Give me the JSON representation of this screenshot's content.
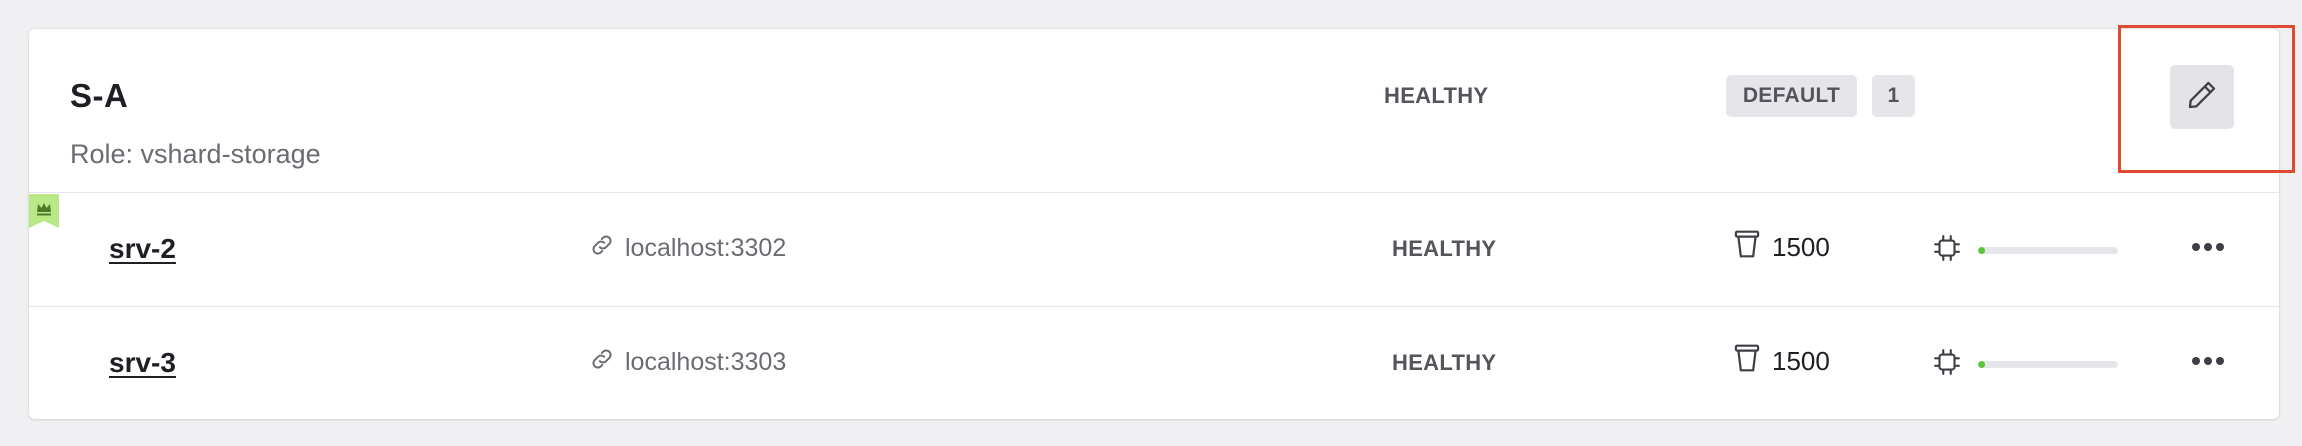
{
  "replicaset": {
    "name": "S-A",
    "role": "Role: vshard-storage",
    "status": "HEALTHY",
    "vshard_group": "DEFAULT",
    "weight": "1"
  },
  "servers": [
    {
      "alias": "srv-2",
      "uri": "localhost:3302",
      "status": "HEALTHY",
      "buckets": "1500",
      "memory_fraction": 0.05,
      "is_leader": true
    },
    {
      "alias": "srv-3",
      "uri": "localhost:3303",
      "status": "HEALTHY",
      "buckets": "1500",
      "memory_fraction": 0.05,
      "is_leader": false
    }
  ],
  "icons": {
    "edit": "pencil-icon",
    "leader": "crown-icon",
    "uri": "link-icon",
    "buckets": "bucket-icon",
    "memory": "chip-icon",
    "more": "more-icon"
  },
  "colors": {
    "accent_highlight": "#e04a32",
    "memory_bar": "#5ac43a",
    "leader_flag": "#b8e986"
  }
}
